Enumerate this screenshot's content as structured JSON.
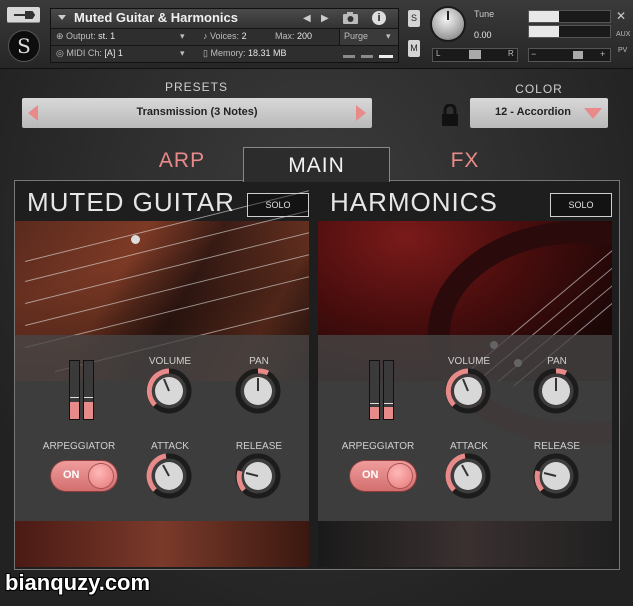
{
  "header": {
    "instrument_title": "Muted Guitar & Harmonics",
    "output_label": "Output:",
    "output_value": "st. 1",
    "voices_label": "Voices:",
    "voices_value": "2",
    "max_label": "Max:",
    "max_value": "200",
    "purge_label": "Purge",
    "midi_label": "MIDI Ch:",
    "midi_value": "[A]  1",
    "memory_label": "Memory:",
    "memory_value": "18.31 MB",
    "s_label": "S",
    "m_label": "M",
    "tune_label": "Tune",
    "tune_value": "0.00",
    "pan_l": "L",
    "pan_r": "R",
    "aux_label": "AUX",
    "pv_label": "PV"
  },
  "presets": {
    "label": "PRESETS",
    "value": "Transmission (3 Notes)"
  },
  "color": {
    "label": "COLOR",
    "value": "12 - Accordion"
  },
  "tabs": [
    {
      "label": "ARP",
      "active": false
    },
    {
      "label": "MAIN",
      "active": true
    },
    {
      "label": "FX",
      "active": false
    }
  ],
  "panels": {
    "left": {
      "title": "MUTED GUITAR",
      "solo": "SOLO",
      "volume_label": "VOLUME",
      "pan_label": "PAN",
      "arp_label": "ARPEGGIATOR",
      "arp_toggle": "ON",
      "attack_label": "ATTACK",
      "release_label": "RELEASE",
      "meter_levels": [
        0.3,
        0.3
      ]
    },
    "right": {
      "title": "HARMONICS",
      "solo": "SOLO",
      "volume_label": "VOLUME",
      "pan_label": "PAN",
      "arp_label": "ARPEGGIATOR",
      "arp_toggle": "ON",
      "attack_label": "ATTACK",
      "release_label": "RELEASE",
      "meter_levels": [
        0.2,
        0.2
      ]
    }
  },
  "accent_color": "#e98a8a",
  "watermark": "bianquzy.com"
}
